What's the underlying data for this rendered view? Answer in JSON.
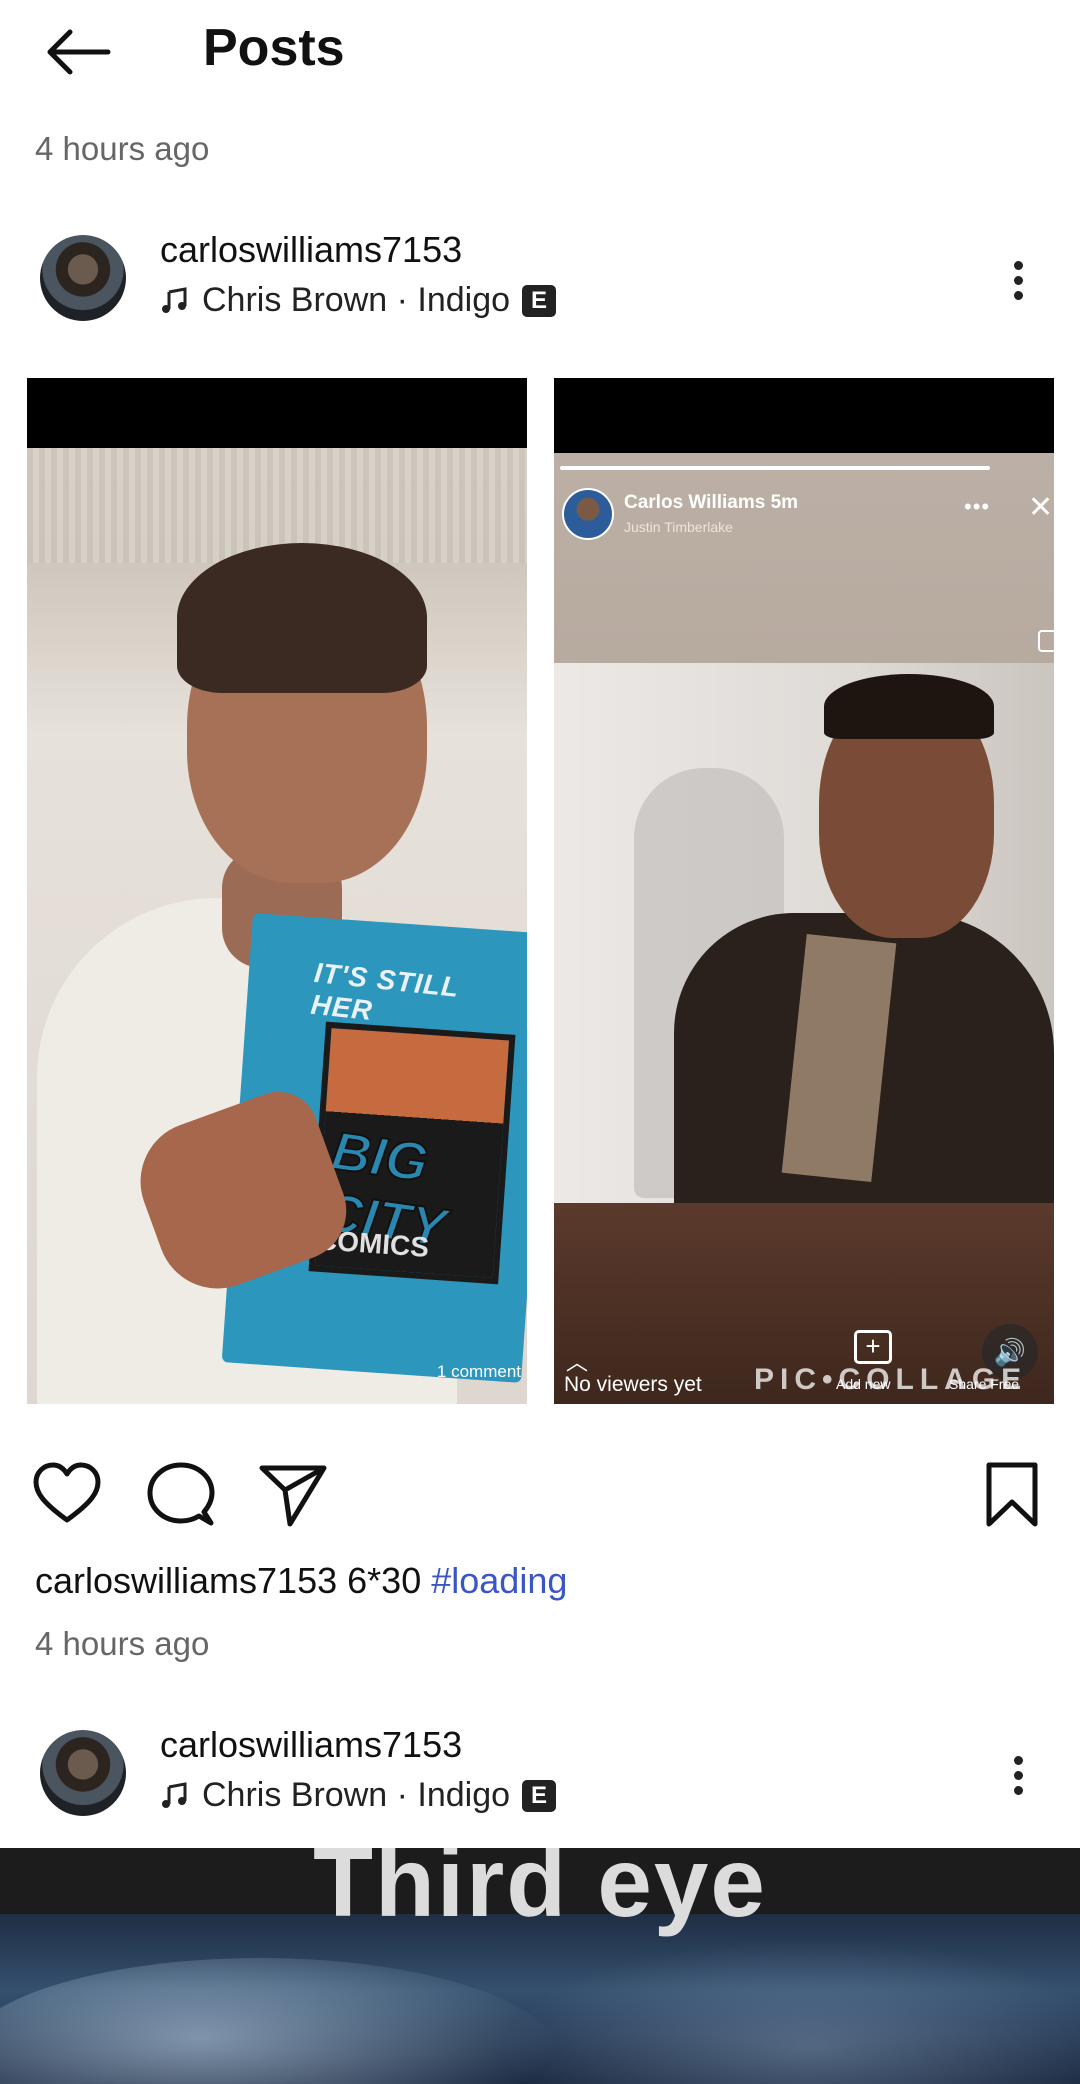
{
  "header": {
    "title": "Posts"
  },
  "top_time": "4 hours ago",
  "post1": {
    "username": "carloswilliams7153",
    "music": "Chris Brown · Indigo",
    "explicit_badge": "E",
    "tile1": {
      "book_title": "IT'S STILL HER",
      "book_big": "BIG CITY",
      "book_comics": "COMICS",
      "comment_count": "1 comment"
    },
    "tile2": {
      "story_name": "Carlos Williams 5m",
      "story_music": "Justin Timberlake",
      "menu_dots": "•••",
      "close": "✕",
      "viewers": "No viewers yet",
      "add_label": "Add new",
      "share_label": "Share Free",
      "watermark": "PIC•COLLAGE"
    },
    "caption_user": "carloswilliams7153",
    "caption_text": "6*30",
    "caption_tag": "#loading",
    "time": "4 hours ago"
  },
  "post2": {
    "username": "carloswilliams7153",
    "music": "Chris Brown · Indigo",
    "explicit_badge": "E",
    "image_title": "Third eye"
  },
  "icons": [
    "back-arrow-icon",
    "music-note-icon",
    "more-vertical-icon",
    "heart-icon",
    "comment-icon",
    "send-icon",
    "bookmark-icon"
  ]
}
